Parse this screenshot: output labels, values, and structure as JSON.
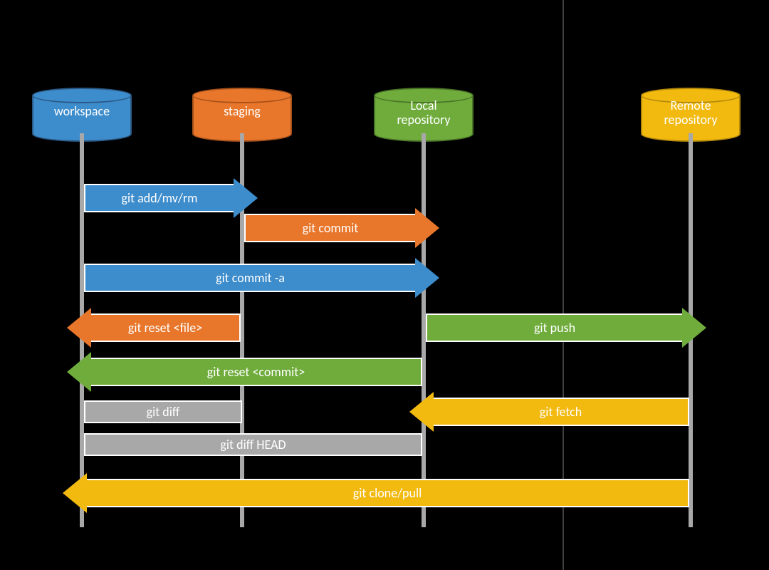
{
  "nodes": {
    "workspace": {
      "label": "workspace",
      "color": "blue"
    },
    "staging": {
      "label": "staging",
      "color": "orange"
    },
    "local": {
      "label": "Local\nrepository",
      "color": "green"
    },
    "remote": {
      "label": "Remote\nrepository",
      "color": "gold"
    }
  },
  "arrows": {
    "add": {
      "label": "git add/mv/rm",
      "from": "workspace",
      "to": "staging",
      "dir": "right",
      "color": "blue"
    },
    "commit": {
      "label": "git commit",
      "from": "staging",
      "to": "local",
      "dir": "right",
      "color": "orange"
    },
    "commit_a": {
      "label": "git commit -a",
      "from": "workspace",
      "to": "local",
      "dir": "right",
      "color": "blue"
    },
    "reset_file": {
      "label": "git reset <file>",
      "from": "staging",
      "to": "workspace",
      "dir": "left",
      "color": "orange"
    },
    "push": {
      "label": "git push",
      "from": "local",
      "to": "remote",
      "dir": "right",
      "color": "green"
    },
    "reset_commit": {
      "label": "git reset <commit>",
      "from": "local",
      "to": "workspace",
      "dir": "left",
      "color": "green"
    },
    "diff": {
      "label": "git diff",
      "from": "workspace",
      "to": "staging",
      "dir": "none",
      "color": "grey"
    },
    "fetch": {
      "label": "git fetch",
      "from": "remote",
      "to": "local",
      "dir": "left",
      "color": "gold"
    },
    "diff_head": {
      "label": "git diff HEAD",
      "from": "workspace",
      "to": "local",
      "dir": "none",
      "color": "grey"
    },
    "clone": {
      "label": "git clone/pull",
      "from": "remote",
      "to": "workspace",
      "dir": "left",
      "color": "gold"
    }
  },
  "colors": {
    "blue": "#3d8ccc",
    "orange": "#e8762b",
    "green": "#6fac3c",
    "gold": "#f2b90f",
    "grey": "#a8a8a8"
  }
}
